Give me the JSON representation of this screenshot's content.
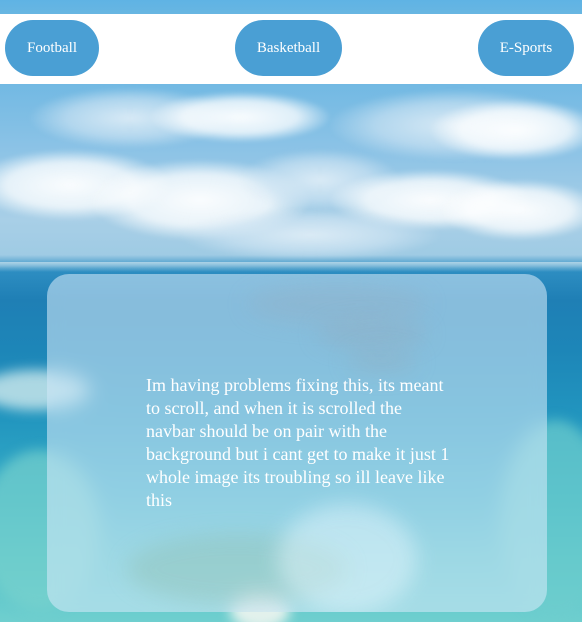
{
  "navbar": {
    "items": [
      {
        "label": "Football"
      },
      {
        "label": "Basketball"
      },
      {
        "label": "E-Sports"
      }
    ]
  },
  "card": {
    "message": "Im having problems fixing this, its meant to scroll, and when it is scrolled the navbar should be on pair with the background but i cant get to make it just 1 whole image its troubling so ill leave like this"
  },
  "colors": {
    "nav_button": "#4a9fd4",
    "nav_bar": "#ffffff",
    "card_glass": "rgba(210,232,248,0.58)",
    "text": "#ffffff"
  },
  "background_image": {
    "subject": "aerial ocean and sky scene"
  }
}
